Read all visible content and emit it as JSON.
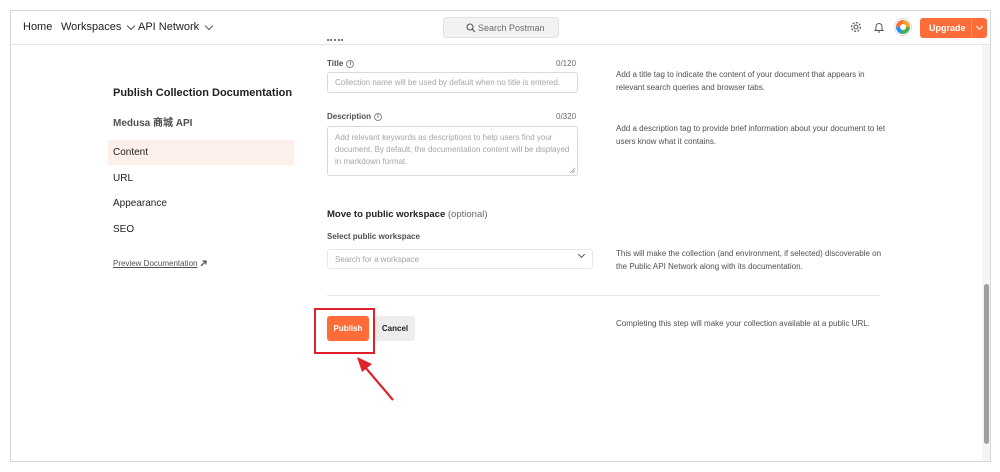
{
  "header": {
    "home": "Home",
    "workspaces": "Workspaces",
    "api_network": "API Network",
    "search_placeholder": "Search Postman",
    "upgrade": "Upgrade"
  },
  "sidebar": {
    "title": "Publish Collection Documentation",
    "collection_name": "Medusa 商城 API",
    "items": [
      {
        "label": "Content",
        "active": true
      },
      {
        "label": "URL",
        "active": false
      },
      {
        "label": "Appearance",
        "active": false
      },
      {
        "label": "SEO",
        "active": false
      }
    ],
    "preview_link": "Preview Documentation"
  },
  "form": {
    "title_label": "Title",
    "title_counter": "0/120",
    "title_placeholder": "Collection name will be used by default when no title is entered.",
    "title_help": "Add a title tag to indicate the content of your document that appears in relevant search queries and browser tabs.",
    "description_label": "Description",
    "description_counter": "0/320",
    "description_placeholder": "Add relevant keywords as descriptions to help users find your document. By default, the documentation content will be displayed in markdown format.",
    "description_help": "Add a description tag to provide brief information about your document to let users know what it contains.",
    "move_title": "Move to public workspace",
    "move_optional": "(optional)",
    "select_label": "Select public workspace",
    "select_placeholder": "Search for a workspace",
    "select_help": "This will make the collection (and environment, if selected) discoverable on the Public API Network along with its documentation.",
    "publish": "Publish",
    "cancel": "Cancel",
    "publish_help": "Completing this step will make your collection available at a public URL."
  },
  "colors": {
    "accent": "#ff6c37",
    "highlight": "#e0202a"
  }
}
